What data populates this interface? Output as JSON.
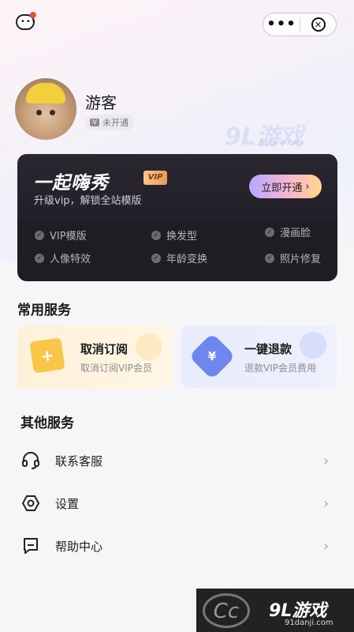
{
  "header": {
    "message_icon": "chat-bubble-icon",
    "more_label": "•••",
    "close_icon": "close-circle-icon"
  },
  "profile": {
    "name": "游客",
    "status": "未开通",
    "status_icon": "vip-v-icon"
  },
  "vip": {
    "title": "一起嗨秀",
    "tag": "VIP",
    "subtitle": "升级vip，解锁全站模版",
    "button": "立即开通",
    "features": [
      "VIP模版",
      "换发型",
      "漫画脸",
      "人像特效",
      "年龄变换",
      "照片修复"
    ]
  },
  "common": {
    "title": "常用服务",
    "cards": [
      {
        "title": "取消订阅",
        "desc": "取消订阅VIP会员",
        "icon": "flag-plus-icon",
        "icon_char": "+"
      },
      {
        "title": "一键退款",
        "desc": "退款VIP会员费用",
        "icon": "yen-icon",
        "icon_char": "¥"
      }
    ]
  },
  "other": {
    "title": "其他服务",
    "items": [
      {
        "label": "联系客服",
        "icon": "headset-icon"
      },
      {
        "label": "设置",
        "icon": "settings-hex-icon"
      },
      {
        "label": "帮助中心",
        "icon": "help-doc-icon"
      }
    ],
    "chevron": "›"
  },
  "watermark": {
    "top": "9L游戏",
    "top_url": "91danji.com",
    "bottom": "9L游戏",
    "bottom_url": "91danji.com"
  },
  "colors": {
    "vip_card_bg": "#1f1d24",
    "cancel_card_bg": "#fdf1d9",
    "refund_card_bg": "#e8ebfb",
    "accent_gold": "#f8c74a",
    "accent_blue": "#6f86ec"
  }
}
